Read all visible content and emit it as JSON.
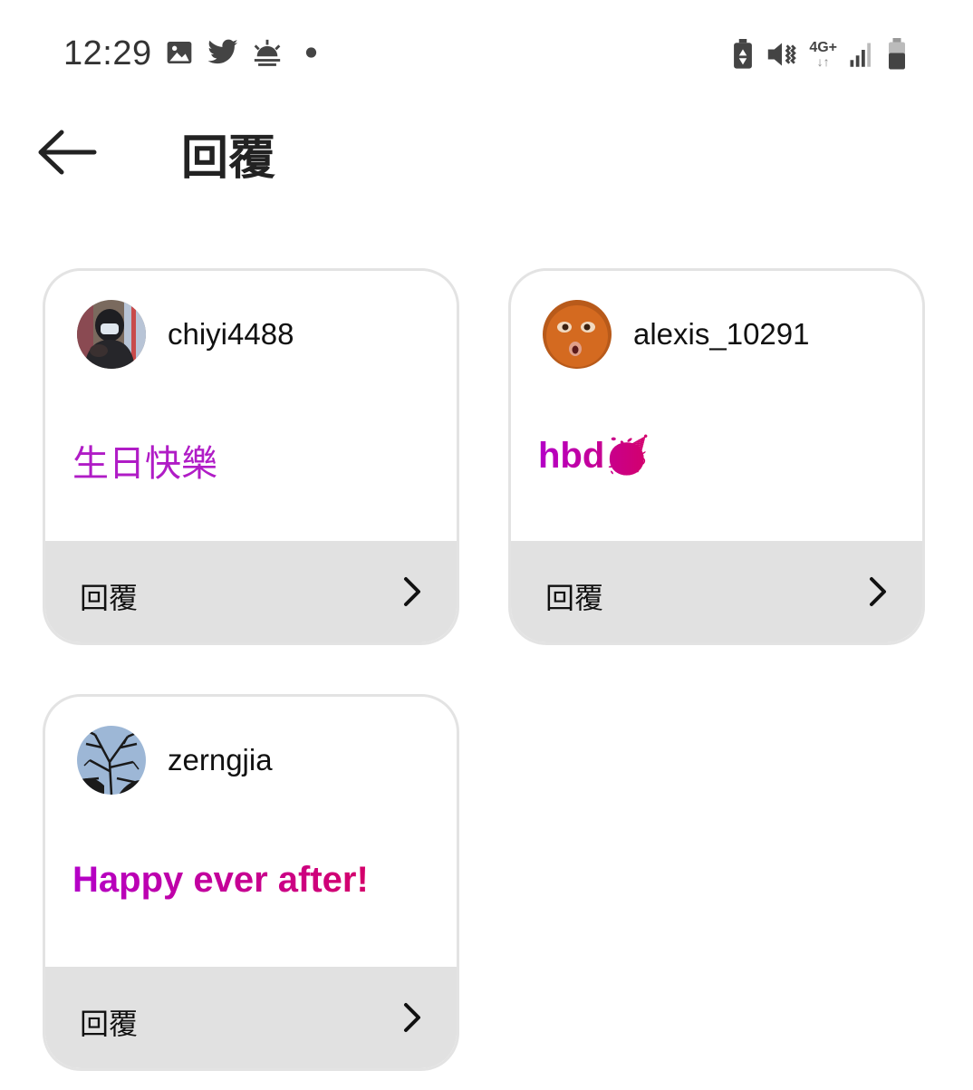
{
  "status_bar": {
    "time": "12:29",
    "left_icons": [
      "gallery-icon",
      "twitter-icon",
      "weather-sunrise-icon",
      "notification-dot-icon"
    ],
    "network_label": "4G+",
    "right_icons": [
      "battery-saver-icon",
      "vibrate-mute-icon",
      "network-4g-icon",
      "signal-icon",
      "battery-icon"
    ]
  },
  "header": {
    "title": "回覆",
    "back_icon": "arrow-left-icon"
  },
  "colors": {
    "gradient_start": "#b400c8",
    "gradient_end": "#d4006a",
    "footer_bg": "#e1e1e1",
    "card_border": "#e3e3e3"
  },
  "replies": [
    {
      "username": "chiyi4488",
      "text": "生日快樂",
      "footer_label": "回覆",
      "avatar": "avatar-person-mask"
    },
    {
      "username": "alexis_10291",
      "text": "hbd🥳",
      "footer_label": "回覆",
      "avatar": "avatar-orange-face"
    },
    {
      "username": "zerngjia",
      "text": "Happy ever after!",
      "footer_label": "回覆",
      "avatar": "avatar-tree-branches"
    }
  ]
}
